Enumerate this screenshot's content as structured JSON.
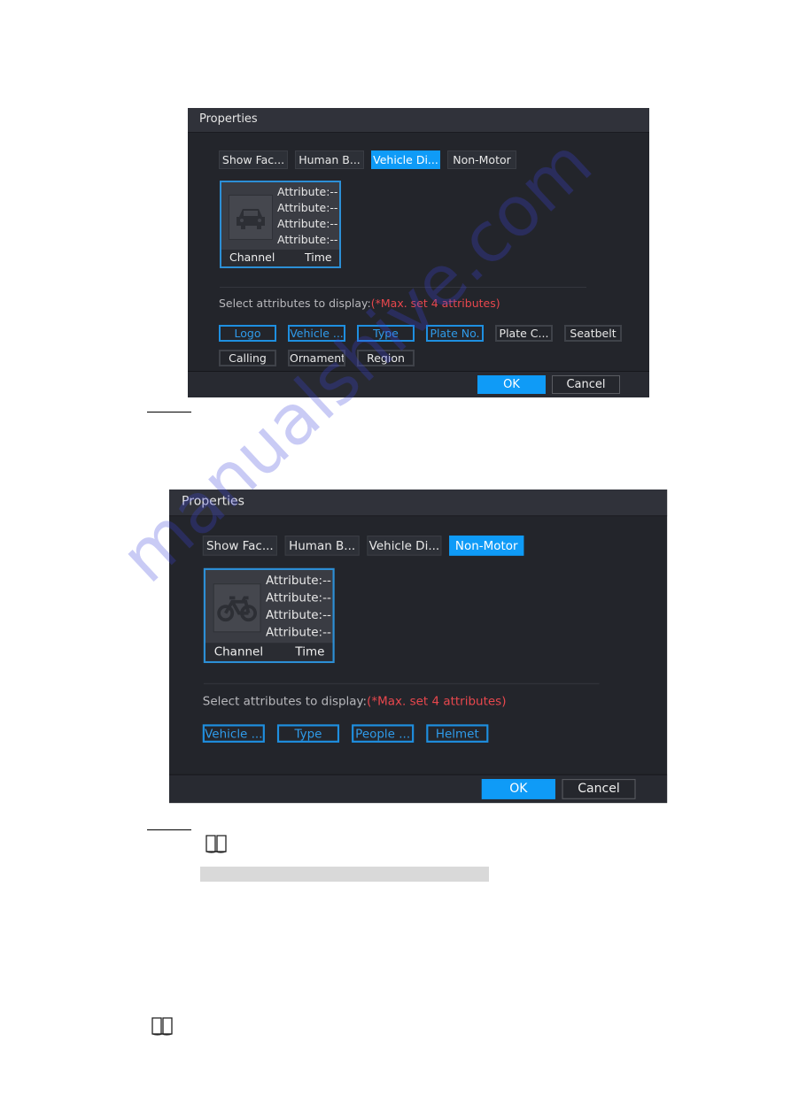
{
  "dialogs": [
    {
      "title": "Properties",
      "tabs": [
        "Show Fac...",
        "Human B...",
        "Vehicle Di...",
        "Non-Motor"
      ],
      "selected_tab": 2,
      "preview": {
        "icon": "car-icon",
        "attributes": [
          "Attribute:--",
          "Attribute:--",
          "Attribute:--",
          "Attribute:--"
        ],
        "channel": "Channel",
        "time": "Time"
      },
      "select_label": "Select attributes to display:",
      "select_warning": "(*Max. set 4 attributes)",
      "attributes": [
        {
          "label": "Logo",
          "selected": true
        },
        {
          "label": "Vehicle ...",
          "selected": true
        },
        {
          "label": "Type",
          "selected": true
        },
        {
          "label": "Plate No.",
          "selected": true
        },
        {
          "label": "Plate C...",
          "selected": false
        },
        {
          "label": "Seatbelt",
          "selected": false
        },
        {
          "label": "Calling",
          "selected": false
        },
        {
          "label": "Ornament",
          "selected": false
        },
        {
          "label": "Region",
          "selected": false
        }
      ],
      "ok_label": "OK",
      "cancel_label": "Cancel"
    },
    {
      "title": "Properties",
      "tabs": [
        "Show Fac...",
        "Human B...",
        "Vehicle Di...",
        "Non-Motor"
      ],
      "selected_tab": 3,
      "preview": {
        "icon": "bicycle-icon",
        "attributes": [
          "Attribute:--",
          "Attribute:--",
          "Attribute:--",
          "Attribute:--"
        ],
        "channel": "Channel",
        "time": "Time"
      },
      "select_label": "Select attributes to display:",
      "select_warning": "(*Max. set 4 attributes)",
      "attributes": [
        {
          "label": "Vehicle ...",
          "selected": true
        },
        {
          "label": "Type",
          "selected": true
        },
        {
          "label": "People ...",
          "selected": true
        },
        {
          "label": "Helmet",
          "selected": true
        }
      ],
      "ok_label": "OK",
      "cancel_label": "Cancel"
    }
  ],
  "colors": {
    "accent": "#0f9bf7",
    "warning": "#e8474d",
    "dialog_bg": "#23252b"
  },
  "watermark": "manualshive.com"
}
